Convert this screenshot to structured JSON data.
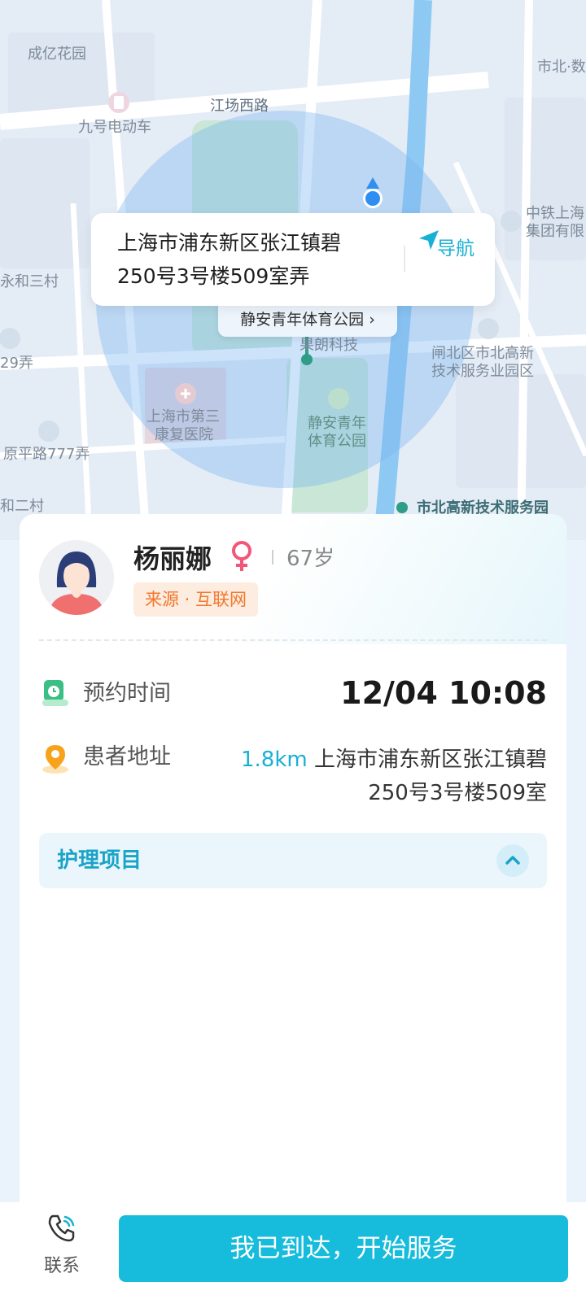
{
  "map": {
    "labels": {
      "chengyi_garden": "成亿花园",
      "jiangchang_west_road": "江场西路",
      "jiuhao_ev": "九号电动车",
      "shibei_data": "市北·数",
      "crcc_group_1": "中铁上海",
      "crcc_group_2": "集团有限",
      "yonghe_3": "永和三村",
      "lane_29": "29弄",
      "yuanping_777": "原平路777弄",
      "yonghe_2": "和二村",
      "rehab_hospital_1": "上海市第三",
      "rehab_hospital_2": "康复医院",
      "jingan_park_1": "静安青年",
      "jingan_park_2": "体育公园",
      "xx_tech": "果朗科技",
      "zhabei_park_1": "闸北区市北高新",
      "zhabei_park_2": "技术服务业园区",
      "shibei_hitech": "市北高新技术服务园"
    },
    "popup": {
      "address": "上海市浦东新区张江镇碧250号3号楼509室弄",
      "nav_label": "导航"
    },
    "poi_chip": "静安青年体育公园 ›"
  },
  "patient": {
    "name": "杨丽娜",
    "gender": "female",
    "age": "67岁",
    "source": "来源 · 互联网"
  },
  "appointment": {
    "label": "预约时间",
    "value": "12/04 10:08"
  },
  "address": {
    "label": "患者地址",
    "distance": "1.8km",
    "text": "上海市浦东新区张江镇碧250号3号楼509室"
  },
  "care": {
    "title": "护理项目"
  },
  "bottom": {
    "contact_label": "联系",
    "arrive_button": "我已到达，开始服务"
  },
  "colors": {
    "accent": "#17bcdc",
    "source_tag_text": "#f2782c",
    "female_icon": "#f2577a"
  }
}
